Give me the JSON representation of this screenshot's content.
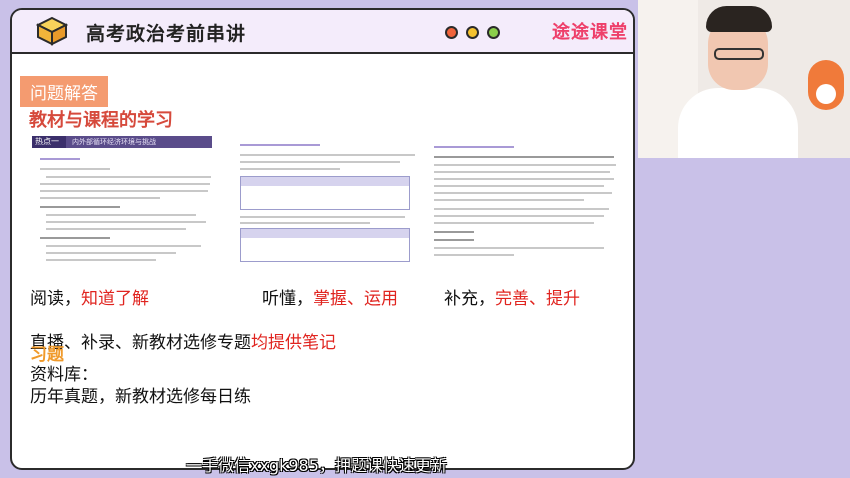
{
  "app": {
    "title": "高考政治考前串讲",
    "brand": "途途课堂",
    "window_dots": [
      "#f0643c",
      "#f5c330",
      "#8bcf4a"
    ],
    "icon": "cube-icon"
  },
  "slide": {
    "tag": "问题解答",
    "title": "教材与课程的学习",
    "doc_banner_left": "热点一",
    "doc_banner_right": "内外部循环经济环境与挑战",
    "row1": [
      {
        "prefix": "阅读，",
        "highlight": "知道了解"
      },
      {
        "prefix": "听懂，",
        "highlight": "掌握、运用"
      },
      {
        "prefix": "补充，",
        "highlight": "完善、提升"
      }
    ],
    "row2_prefix": "直播、补录、新教材选修专题",
    "row2_highlight": "均提供笔记",
    "exercise_title": "习题",
    "library_label": "资料库：",
    "library_items": "历年真题，新教材选修每日练"
  },
  "caption": "一手微信xxgk985，押题课快速更新"
}
